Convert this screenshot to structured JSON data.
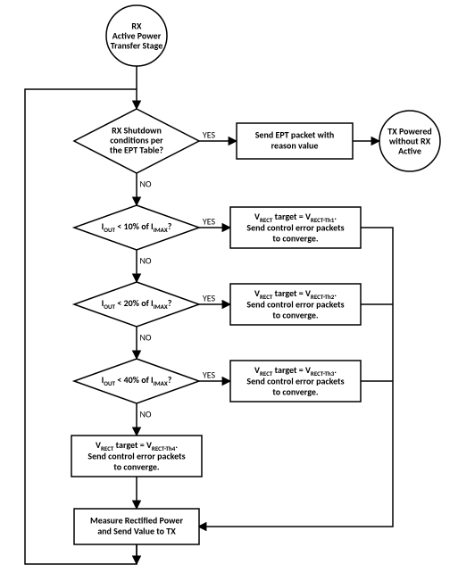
{
  "chart_data": {
    "type": "flowchart",
    "start": {
      "label_l1": "RX",
      "label_l2": "Active Power",
      "label_l3": "Transfer Stage"
    },
    "decision1": {
      "l1": "RX Shutdown",
      "l2": "conditions per",
      "l3": "the EPT Table?"
    },
    "action1": {
      "l1": "Send EPT packet with",
      "l2": "reason value"
    },
    "end1": {
      "l1": "TX Powered",
      "l2": "without RX",
      "l3": "Active"
    },
    "decision2": {
      "pre": "I",
      "sub1": "OUT",
      "mid": " < 10% of I",
      "sub2": "IMAX",
      "post": "?"
    },
    "action2": {
      "pre": "V",
      "sub1": "RECT",
      "mid": " target = V",
      "sub2": "RECT-Th1",
      "post": ".",
      "l2": "Send control error packets",
      "l3": "to converge."
    },
    "decision3": {
      "pre": "I",
      "sub1": "OUT",
      "mid": " < 20% of I",
      "sub2": "IMAX",
      "post": "?"
    },
    "action3": {
      "pre": "V",
      "sub1": "RECT",
      "mid": " target = V",
      "sub2": "RECT-Th2",
      "post": ".",
      "l2": "Send control error packets",
      "l3": "to converge."
    },
    "decision4": {
      "pre": "I",
      "sub1": "OUT",
      "mid": " < 40% of I",
      "sub2": "IMAX",
      "post": "?"
    },
    "action4": {
      "pre": "V",
      "sub1": "RECT",
      "mid": " target = V",
      "sub2": "RECT-Th3",
      "post": ".",
      "l2": "Send control error packets",
      "l3": "to converge."
    },
    "final_action": {
      "pre": "V",
      "sub1": "RECT",
      "mid": " target = V",
      "sub2": "RECT-Th4",
      "post": ".",
      "l2": "Send control error packets",
      "l3": "to converge."
    },
    "measure": {
      "l1": "Measure Rectified Power",
      "l2": "and Send Value to TX"
    },
    "labels": {
      "yes": "YES",
      "no": "NO"
    }
  }
}
